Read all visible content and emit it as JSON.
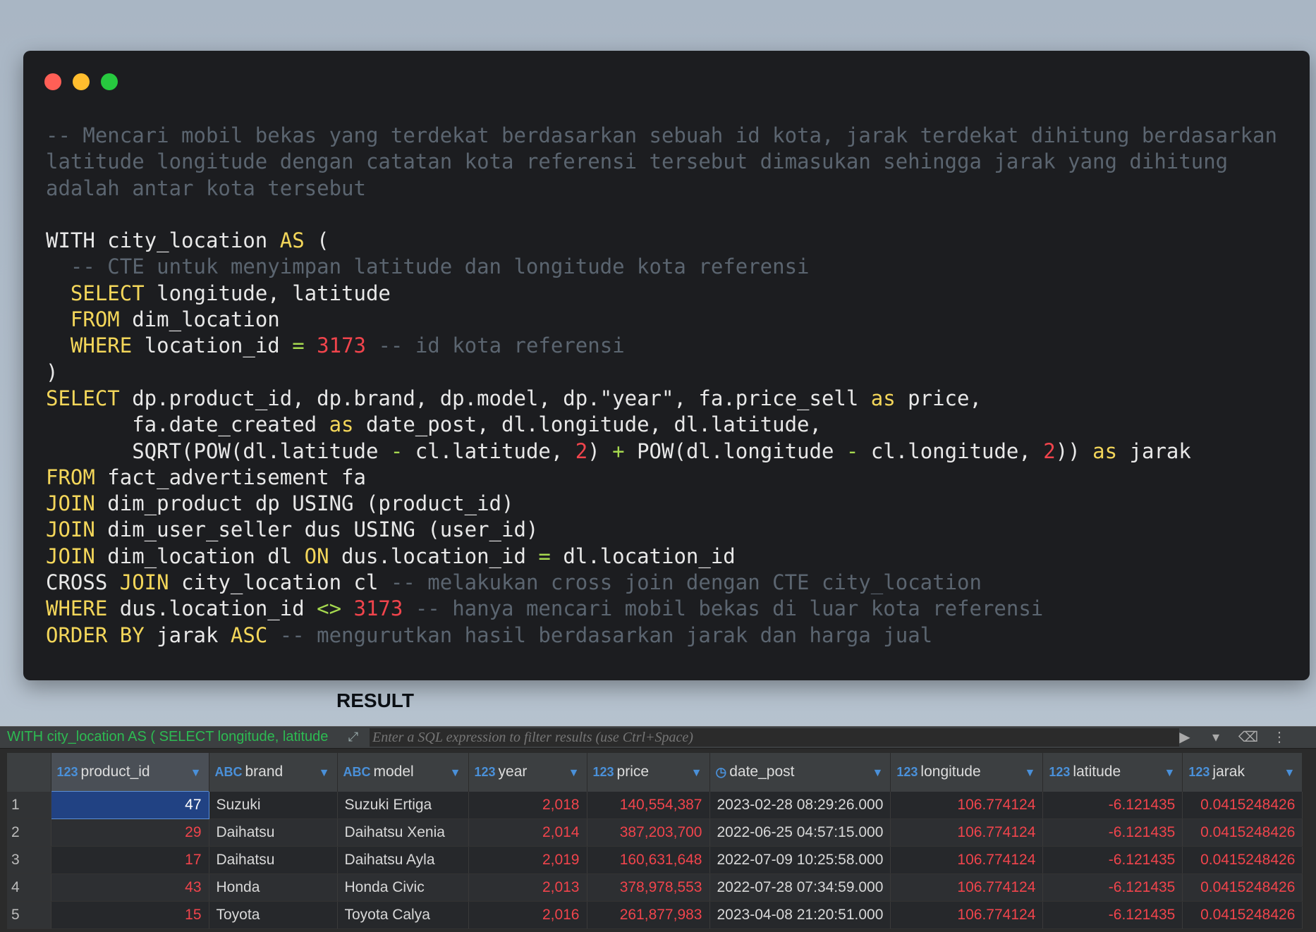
{
  "window": {
    "controls": [
      "close",
      "minimize",
      "maximize"
    ],
    "colors": {
      "close": "#ff5f56",
      "minimize": "#ffbd2e",
      "maximize": "#27c93f"
    }
  },
  "code": {
    "lines": [
      [
        {
          "t": "-- Mencari mobil bekas yang terdekat berdasarkan sebuah id kota, jarak terdekat dihitung berdasarkan latitude longitude dengan catatan kota referensi tersebut dimasukan sehingga jarak yang dihitung adalah antar kota tersebut",
          "c": "cm"
        }
      ],
      [],
      [
        {
          "t": "WITH city_location ",
          "c": ""
        },
        {
          "t": "AS",
          "c": "kw"
        },
        {
          "t": " (",
          "c": ""
        }
      ],
      [
        {
          "t": "  -- CTE untuk menyimpan latitude dan longitude kota referensi",
          "c": "cm"
        }
      ],
      [
        {
          "t": "  ",
          "c": ""
        },
        {
          "t": "SELECT",
          "c": "kw"
        },
        {
          "t": " longitude, latitude",
          "c": ""
        }
      ],
      [
        {
          "t": "  ",
          "c": ""
        },
        {
          "t": "FROM",
          "c": "kw"
        },
        {
          "t": " dim_location",
          "c": ""
        }
      ],
      [
        {
          "t": "  ",
          "c": ""
        },
        {
          "t": "WHERE",
          "c": "kw"
        },
        {
          "t": " location_id ",
          "c": ""
        },
        {
          "t": "=",
          "c": "op"
        },
        {
          "t": " ",
          "c": ""
        },
        {
          "t": "3173",
          "c": "num"
        },
        {
          "t": " -- id kota referensi",
          "c": "cm"
        }
      ],
      [
        {
          "t": ")",
          "c": ""
        }
      ],
      [
        {
          "t": "SELECT",
          "c": "kw"
        },
        {
          "t": " dp.product_id, dp.brand, dp.model, dp.\"year\", fa.price_sell ",
          "c": ""
        },
        {
          "t": "as",
          "c": "kw"
        },
        {
          "t": " price,",
          "c": ""
        }
      ],
      [
        {
          "t": "       fa.date_created ",
          "c": ""
        },
        {
          "t": "as",
          "c": "kw"
        },
        {
          "t": " date_post, dl.longitude, dl.latitude,",
          "c": ""
        }
      ],
      [
        {
          "t": "       SQRT(POW(dl.latitude ",
          "c": ""
        },
        {
          "t": "-",
          "c": "op"
        },
        {
          "t": " cl.latitude, ",
          "c": ""
        },
        {
          "t": "2",
          "c": "num"
        },
        {
          "t": ") ",
          "c": ""
        },
        {
          "t": "+",
          "c": "op"
        },
        {
          "t": " POW(dl.longitude ",
          "c": ""
        },
        {
          "t": "-",
          "c": "op"
        },
        {
          "t": " cl.longitude, ",
          "c": ""
        },
        {
          "t": "2",
          "c": "num"
        },
        {
          "t": ")) ",
          "c": ""
        },
        {
          "t": "as",
          "c": "kw"
        },
        {
          "t": " jarak",
          "c": ""
        }
      ],
      [
        {
          "t": "FROM",
          "c": "kw"
        },
        {
          "t": " fact_advertisement fa",
          "c": ""
        }
      ],
      [
        {
          "t": "JOIN",
          "c": "kw"
        },
        {
          "t": " dim_product dp USING (product_id)",
          "c": ""
        }
      ],
      [
        {
          "t": "JOIN",
          "c": "kw"
        },
        {
          "t": " dim_user_seller dus USING (user_id)",
          "c": ""
        }
      ],
      [
        {
          "t": "JOIN",
          "c": "kw"
        },
        {
          "t": " dim_location dl ",
          "c": ""
        },
        {
          "t": "ON",
          "c": "kw"
        },
        {
          "t": " dus.location_id ",
          "c": ""
        },
        {
          "t": "=",
          "c": "op"
        },
        {
          "t": " dl.location_id",
          "c": ""
        }
      ],
      [
        {
          "t": "CROSS ",
          "c": ""
        },
        {
          "t": "JOIN",
          "c": "kw"
        },
        {
          "t": " city_location cl ",
          "c": ""
        },
        {
          "t": "-- melakukan cross join dengan CTE city_location",
          "c": "cm"
        }
      ],
      [
        {
          "t": "WHERE",
          "c": "kw"
        },
        {
          "t": " dus.location_id ",
          "c": ""
        },
        {
          "t": "<>",
          "c": "op"
        },
        {
          "t": " ",
          "c": ""
        },
        {
          "t": "3173",
          "c": "num"
        },
        {
          "t": " -- hanya mencari mobil bekas di luar kota referensi",
          "c": "cm"
        }
      ],
      [
        {
          "t": "ORDER BY",
          "c": "kw"
        },
        {
          "t": " jarak ",
          "c": ""
        },
        {
          "t": "ASC",
          "c": "kw"
        },
        {
          "t": " -- mengurutkan hasil berdasarkan jarak dan harga jual",
          "c": "cm"
        }
      ]
    ]
  },
  "result_label": "RESULT",
  "results_panel": {
    "query_preview": "WITH city_location AS ( SELECT longitude, latitude",
    "filter_placeholder": "Enter a SQL expression to filter results (use Ctrl+Space)",
    "columns": [
      {
        "type": "123",
        "name": "product_id"
      },
      {
        "type": "ABC",
        "name": "brand"
      },
      {
        "type": "ABC",
        "name": "model"
      },
      {
        "type": "123",
        "name": "year"
      },
      {
        "type": "123",
        "name": "price"
      },
      {
        "type": "clock",
        "name": "date_post"
      },
      {
        "type": "123",
        "name": "longitude"
      },
      {
        "type": "123",
        "name": "latitude"
      },
      {
        "type": "123",
        "name": "jarak"
      }
    ],
    "rows": [
      [
        "1",
        "47",
        "Suzuki",
        "Suzuki Ertiga",
        "2,018",
        "140,554,387",
        "2023-02-28 08:29:26.000",
        "106.774124",
        "-6.121435",
        "0.0415248426"
      ],
      [
        "2",
        "29",
        "Daihatsu",
        "Daihatsu Xenia",
        "2,014",
        "387,203,700",
        "2022-06-25 04:57:15.000",
        "106.774124",
        "-6.121435",
        "0.0415248426"
      ],
      [
        "3",
        "17",
        "Daihatsu",
        "Daihatsu Ayla",
        "2,019",
        "160,631,648",
        "2022-07-09 10:25:58.000",
        "106.774124",
        "-6.121435",
        "0.0415248426"
      ],
      [
        "4",
        "43",
        "Honda",
        "Honda Civic",
        "2,013",
        "378,978,553",
        "2022-07-28 07:34:59.000",
        "106.774124",
        "-6.121435",
        "0.0415248426"
      ],
      [
        "5",
        "15",
        "Toyota",
        "Toyota Calya",
        "2,016",
        "261,877,983",
        "2023-04-08 21:20:51.000",
        "106.774124",
        "-6.121435",
        "0.0415248426"
      ]
    ]
  }
}
